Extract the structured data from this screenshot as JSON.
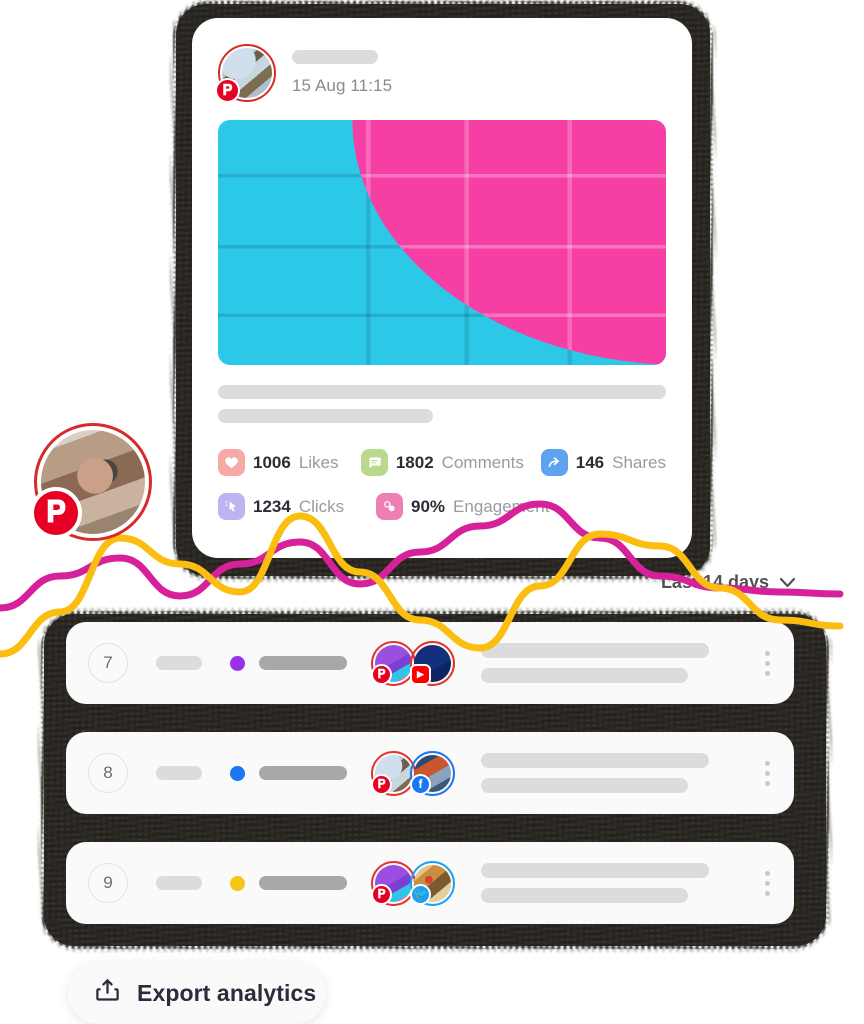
{
  "post": {
    "author_placeholder": "",
    "timestamp": "15 Aug 11:15",
    "network_badge": "pinterest-icon",
    "media": {
      "description": "painted brick wall",
      "color_cyan": "#2CC8E8",
      "color_pink": "#F53FA5"
    },
    "stats": [
      {
        "icon": "heart-icon",
        "value": "1006",
        "label": "Likes",
        "color": "#F7A9A6"
      },
      {
        "icon": "comment-icon",
        "value": "1802",
        "label": "Comments",
        "color": "#BBD98C"
      },
      {
        "icon": "share-icon",
        "value": "146",
        "label": "Shares",
        "color": "#5EA2F0"
      },
      {
        "icon": "click-icon",
        "value": "1234",
        "label": "Clicks",
        "color": "#BEB4F2"
      },
      {
        "icon": "engagement-icon",
        "value": "90%",
        "label": "Engagement",
        "color": "#F080B4"
      }
    ]
  },
  "floating_avatar": {
    "network_badge": "pinterest-icon",
    "ring_color": "#D62B2B"
  },
  "range_picker": {
    "label": "Last 14 days",
    "chevron": "chevron-down-icon"
  },
  "chart_data": {
    "type": "line",
    "title": "",
    "xlabel": "",
    "ylabel": "",
    "grid": false,
    "legend": "none",
    "series": [
      {
        "name": "magenta-series",
        "color": "#D6219B",
        "points": [
          [
            0,
            128
          ],
          [
            60,
            96
          ],
          [
            120,
            78
          ],
          [
            180,
            116
          ],
          [
            240,
            84
          ],
          [
            300,
            62
          ],
          [
            360,
            104
          ],
          [
            420,
            72
          ],
          [
            480,
            46
          ],
          [
            540,
            24
          ],
          [
            600,
            58
          ],
          [
            660,
            96
          ],
          [
            720,
            108
          ],
          [
            780,
            112
          ],
          [
            840,
            114
          ]
        ]
      },
      {
        "name": "yellow-series",
        "color": "#FBBE10",
        "points": [
          [
            0,
            174
          ],
          [
            60,
            132
          ],
          [
            120,
            58
          ],
          [
            180,
            84
          ],
          [
            240,
            112
          ],
          [
            300,
            36
          ],
          [
            360,
            92
          ],
          [
            420,
            140
          ],
          [
            480,
            168
          ],
          [
            540,
            106
          ],
          [
            600,
            54
          ],
          [
            660,
            66
          ],
          [
            720,
            108
          ],
          [
            780,
            140
          ],
          [
            840,
            146
          ]
        ]
      }
    ]
  },
  "list": {
    "rows": [
      {
        "number": "7",
        "dot_color": "#9B30E8",
        "avatars": [
          {
            "id": "avatar-gradient-purple",
            "ring": "#E0342C",
            "badge": "pinterest-icon",
            "badge_color": "#E60023"
          },
          {
            "id": "avatar-blue-photo",
            "ring": "#E0342C",
            "badge": "youtube-icon",
            "badge_color": "#FF0000"
          }
        ],
        "menu": "more-vertical-icon"
      },
      {
        "number": "8",
        "dot_color": "#1877F2",
        "avatars": [
          {
            "id": "avatar-palm-sky",
            "ring": "#E0342C",
            "badge": "pinterest-icon",
            "badge_color": "#E60023"
          },
          {
            "id": "avatar-person-red",
            "ring": "#1877F2",
            "badge": "facebook-icon",
            "badge_color": "#1877F2"
          }
        ],
        "menu": "more-vertical-icon"
      },
      {
        "number": "9",
        "dot_color": "#F5C518",
        "avatars": [
          {
            "id": "avatar-gradient-purple-2",
            "ring": "#E0342C",
            "badge": "pinterest-icon",
            "badge_color": "#E60023"
          },
          {
            "id": "avatar-food",
            "ring": "#1DA1F2",
            "badge": "twitter-icon",
            "badge_color": "#1DA1F2"
          }
        ],
        "menu": "more-vertical-icon"
      }
    ]
  },
  "export_button": {
    "label": "Export analytics",
    "icon": "upload-icon"
  }
}
